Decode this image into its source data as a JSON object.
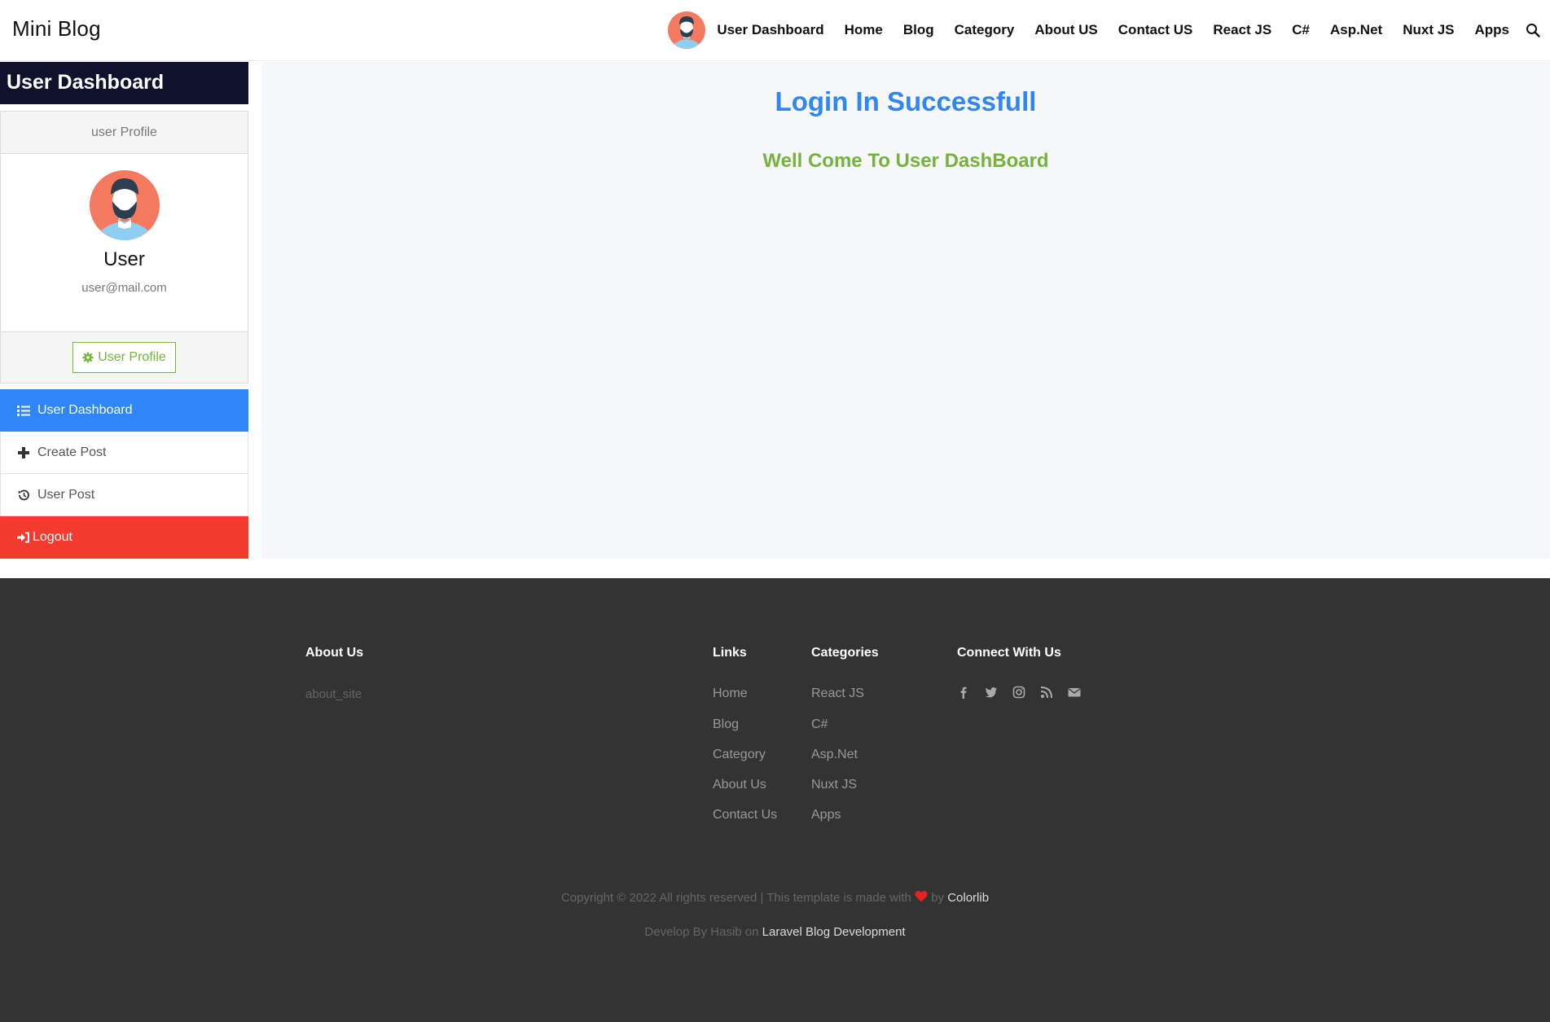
{
  "header": {
    "brand": "Mini Blog",
    "nav": [
      "User Dashboard",
      "Home",
      "Blog",
      "Category",
      "About US",
      "Contact US",
      "React JS",
      "C#",
      "Asp.Net",
      "Nuxt JS",
      "Apps"
    ],
    "search_icon": "search-icon"
  },
  "sidebar": {
    "title": "User Dashboard",
    "profile": {
      "header": "user Profile",
      "name": "User",
      "email": "user@mail.com",
      "button": "User Profile",
      "button_icon": "gear-icon"
    },
    "menu": [
      {
        "label": "User Dashboard",
        "icon": "list-icon",
        "state": "active"
      },
      {
        "label": "Create Post",
        "icon": "plus-icon",
        "state": "normal"
      },
      {
        "label": "User Post",
        "icon": "history-icon",
        "state": "normal"
      },
      {
        "label": "Logout",
        "icon": "sign-in-icon",
        "state": "danger"
      }
    ]
  },
  "main": {
    "heading": "Login In Successfull",
    "subheading": "Well Come To User DashBoard"
  },
  "footer": {
    "about_title": "About Us",
    "about_text": "about_site",
    "links_title": "Links",
    "links": [
      "Home",
      "Blog",
      "Category",
      "About Us",
      "Contact Us"
    ],
    "categories_title": "Categories",
    "categories": [
      "React JS",
      "C#",
      "Asp.Net",
      "Nuxt JS",
      "Apps"
    ],
    "connect_title": "Connect With Us",
    "social_icons": [
      "facebook-icon",
      "twitter-icon",
      "instagram-icon",
      "rss-icon",
      "envelope-icon"
    ],
    "copyright_prefix": "Copyright © 2022 All rights reserved | This template is made with",
    "copyright_by": "by",
    "copyright_link": "Colorlib",
    "dev_prefix": "Develop By Hasib on",
    "dev_link": "Laravel Blog Development"
  },
  "colors": {
    "primary": "#2f86f6",
    "success": "#75b33e",
    "danger": "#f23a2f",
    "sidebar_title_bg": "#10112d",
    "footer_bg": "#333333",
    "heart": "#e8231f"
  }
}
